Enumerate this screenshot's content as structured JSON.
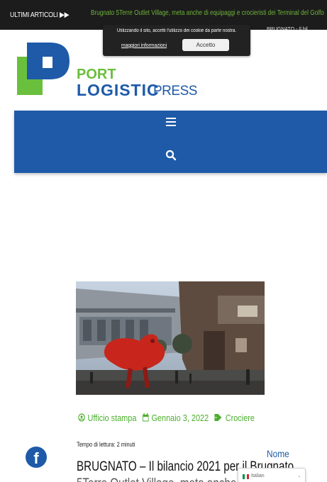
{
  "ticker": {
    "label": "ULTIMI ARTICOLI",
    "label_icon": "double-chevron-right-icon",
    "headline": "Brugnato 5Terre Outlet Village, meta anche di equipaggi e crocieristi dei Terminal del Golfo",
    "right_text": "BRUGNATO - Il bil..."
  },
  "cookie": {
    "message": "Utilizzando il sito, accetti l'utilizzo dei cookie da parte nostra.",
    "more_link": "maggiori informazioni",
    "accept_label": "Accetto"
  },
  "logo": {
    "port": "PORT",
    "logistic": "LOGISTIC",
    "press": "PRESS",
    "colors": {
      "green": "#6abf3c",
      "blue": "#1e5aa8"
    }
  },
  "nav": {
    "menu_icon": "hamburger-menu-icon",
    "search_icon": "search-icon",
    "color": "#1e5aa8"
  },
  "post": {
    "author": "Ufficio stampa",
    "date": "Gennaio 3, 2022",
    "category": "Crociere",
    "reading_time": "Tempo di lettura: 2 minuti",
    "title_line1": "BRUGNATO – Il bilancio 2021 per il Brugnato",
    "title_line2": "5Terre Outlet Village, meta anche..."
  },
  "sidebar": {
    "nome_label": "Nome"
  },
  "language": {
    "current": "Italian"
  }
}
